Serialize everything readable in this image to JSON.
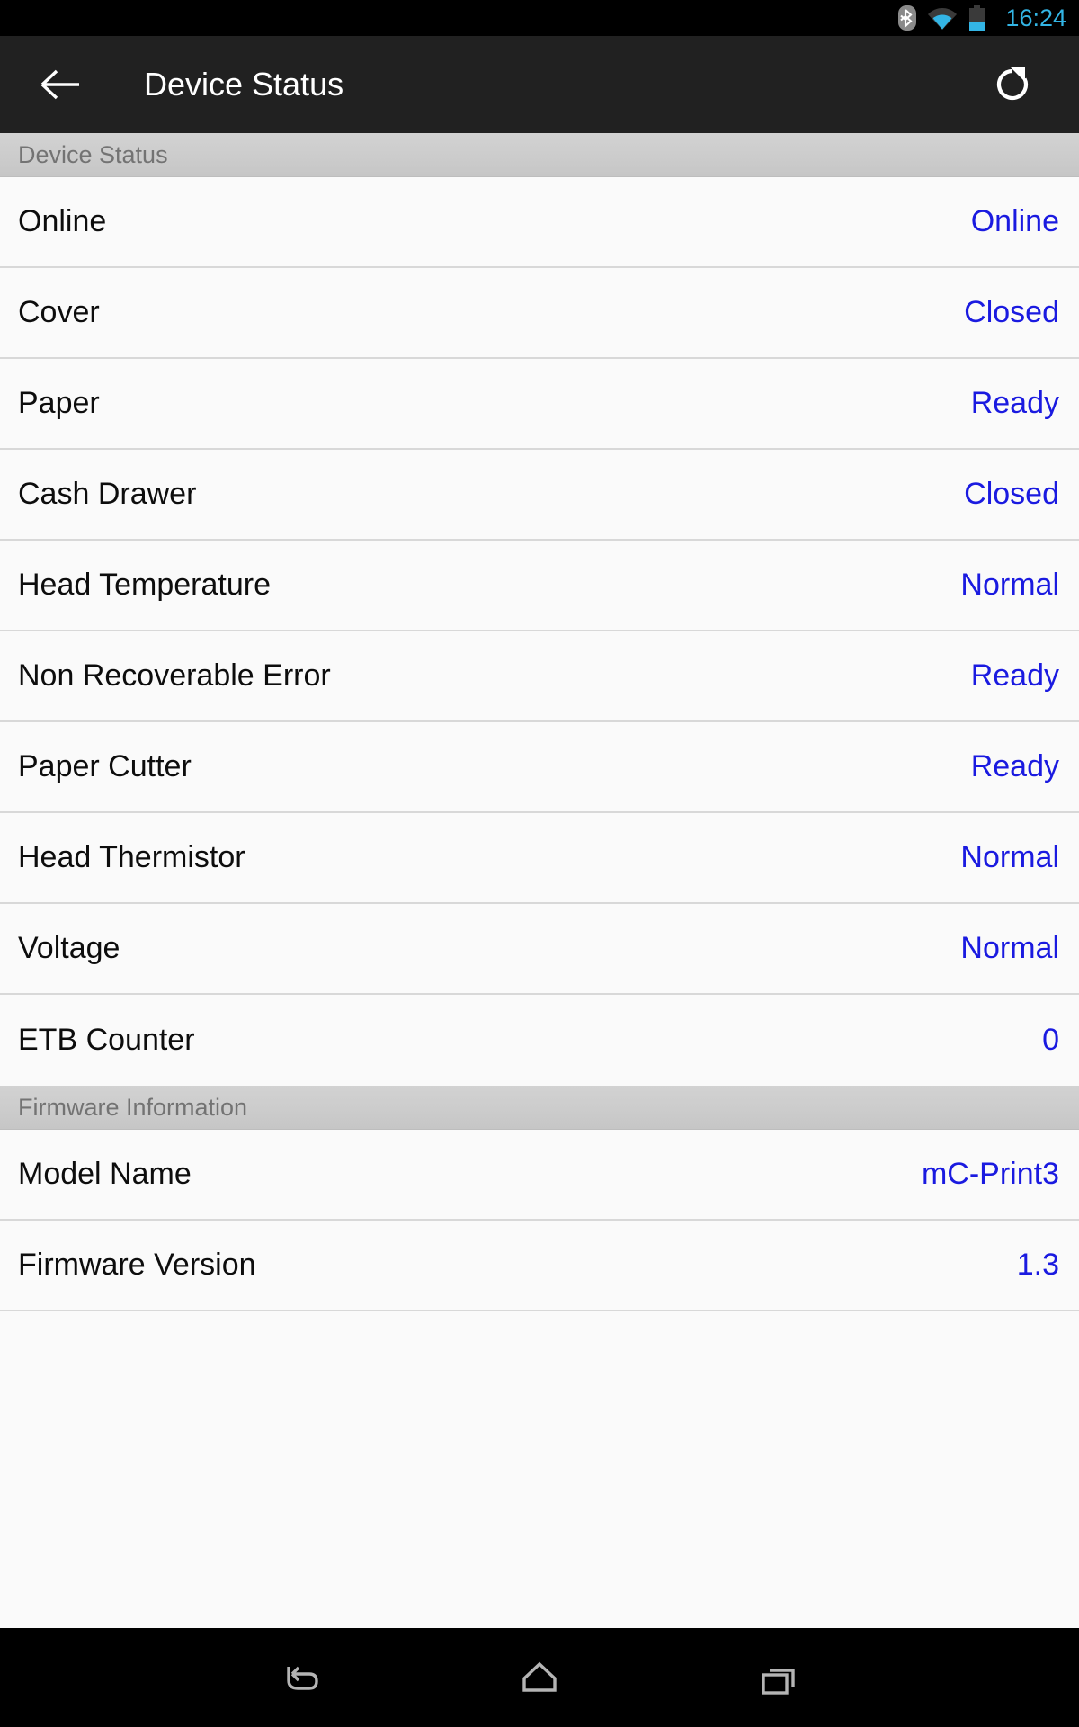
{
  "status_bar": {
    "time": "16:24",
    "icons": [
      "bluetooth-icon",
      "wifi-icon",
      "battery-icon"
    ],
    "accent_color": "#33b5e5",
    "background": "#000000"
  },
  "app_bar": {
    "back_label": "back-arrow-icon",
    "title": "Device Status",
    "refresh_label": "refresh-icon",
    "background": "#212121",
    "text_color": "#ffffff"
  },
  "colors": {
    "value_blue": "#1a1ae0",
    "label_black": "#0d0d0d",
    "section_header_bg": "#cccccc",
    "section_header_text": "#737373",
    "row_bg": "#fafafa",
    "divider": "#d8d8d8"
  },
  "sections": [
    {
      "title": "Device Status",
      "rows": [
        {
          "label": "Online",
          "value": "Online"
        },
        {
          "label": "Cover",
          "value": "Closed"
        },
        {
          "label": "Paper",
          "value": "Ready"
        },
        {
          "label": "Cash Drawer",
          "value": "Closed"
        },
        {
          "label": "Head Temperature",
          "value": "Normal"
        },
        {
          "label": "Non Recoverable Error",
          "value": "Ready"
        },
        {
          "label": "Paper Cutter",
          "value": "Ready"
        },
        {
          "label": "Head Thermistor",
          "value": "Normal"
        },
        {
          "label": "Voltage",
          "value": "Normal"
        },
        {
          "label": "ETB Counter",
          "value": "0"
        }
      ]
    },
    {
      "title": "Firmware Information",
      "rows": [
        {
          "label": "Model Name",
          "value": "mC-Print3"
        },
        {
          "label": "Firmware Version",
          "value": "1.3"
        }
      ]
    }
  ],
  "nav_bar": {
    "buttons": [
      {
        "name": "back-nav-icon"
      },
      {
        "name": "home-nav-icon"
      },
      {
        "name": "recents-nav-icon"
      }
    ],
    "background": "#000000"
  }
}
